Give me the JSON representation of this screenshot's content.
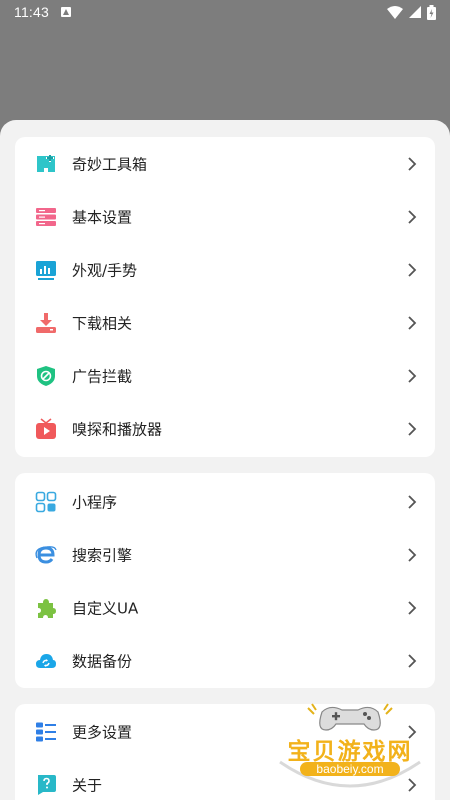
{
  "status": {
    "time": "11:43"
  },
  "groups": [
    {
      "items": [
        {
          "label": "奇妙工具箱",
          "icon": "toolbox-icon",
          "color": "#2ec5c9"
        },
        {
          "label": "基本设置",
          "icon": "settings-list-icon",
          "color": "#f2668b"
        },
        {
          "label": "外观/手势",
          "icon": "appearance-monitor-icon",
          "color": "#1aa3d6"
        },
        {
          "label": "下载相关",
          "icon": "download-icon",
          "color": "#f06a6a"
        },
        {
          "label": "广告拦截",
          "icon": "ad-block-shield-icon",
          "color": "#1fc282"
        },
        {
          "label": "嗅探和播放器",
          "icon": "tv-player-icon",
          "color": "#f0595b"
        }
      ]
    },
    {
      "items": [
        {
          "label": "小程序",
          "icon": "mini-program-grid-icon",
          "color": "#39a9e0"
        },
        {
          "label": "搜索引擎",
          "icon": "search-engine-e-icon",
          "color": "#3b8fe0"
        },
        {
          "label": "自定义UA",
          "icon": "puzzle-icon",
          "color": "#7cc242"
        },
        {
          "label": "数据备份",
          "icon": "cloud-sync-icon",
          "color": "#1aa6e8"
        }
      ]
    },
    {
      "items": [
        {
          "label": "更多设置",
          "icon": "more-settings-list-icon",
          "color": "#2f7fe6"
        },
        {
          "label": "关于",
          "icon": "about-question-icon",
          "color": "#28b8c8"
        }
      ]
    }
  ],
  "watermark": {
    "title": "宝贝游戏网",
    "url": "baobeiy.com"
  }
}
